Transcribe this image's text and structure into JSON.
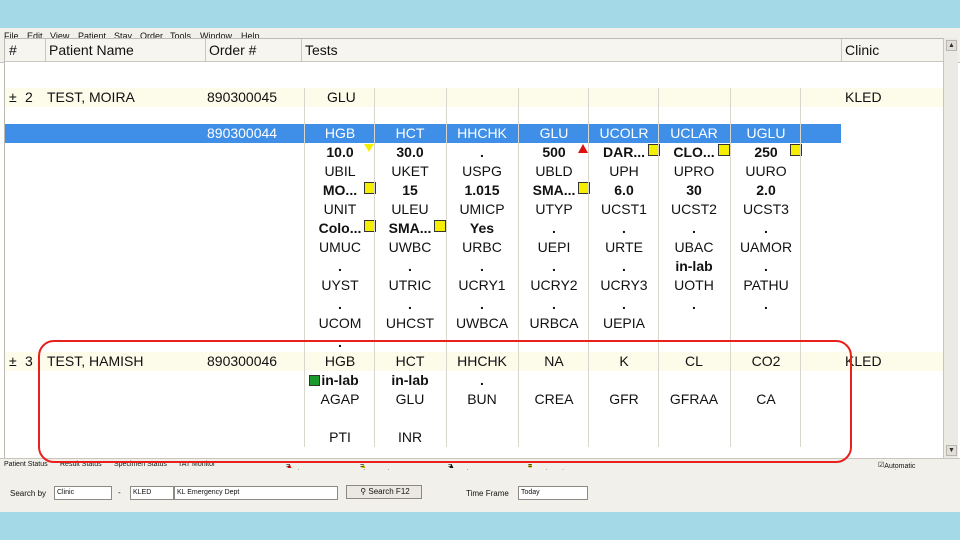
{
  "menu": [
    "File",
    "Edit",
    "View",
    "Patient",
    "Stay",
    "Order",
    "Tools",
    "Window",
    "Help"
  ],
  "columns": {
    "num": "#",
    "patient": "Patient Name",
    "order": "Order #",
    "tests": "Tests",
    "clinic": "Clinic"
  },
  "rows": [
    {
      "num": "2",
      "name": "TEST, MOIRA",
      "order": "890300045",
      "test": "GLU",
      "clinic": "KLED"
    },
    {
      "order": "890300044"
    },
    {
      "num": "3",
      "name": "TEST, HAMISH",
      "order": "890300046",
      "clinic": "KLED"
    }
  ],
  "grid": [
    [
      "HGB",
      "HCT",
      "HHCHK",
      "GLU",
      "UCOLR",
      "UCLAR",
      "UGLU"
    ],
    [
      "10.0",
      "30.0",
      ".",
      "500",
      "DAR...",
      "CLO...",
      "250"
    ],
    [
      "UBIL",
      "UKET",
      "USPG",
      "UBLD",
      "UPH",
      "UPRO",
      "UURO"
    ],
    [
      "MO...",
      "15",
      "1.015",
      "SMA...",
      "6.0",
      "30",
      "2.0"
    ],
    [
      "UNIT",
      "ULEU",
      "UMICP",
      "UTYP",
      "UCST1",
      "UCST2",
      "UCST3"
    ],
    [
      "Colo...",
      "SMA...",
      "Yes",
      ".",
      ".",
      ".",
      "."
    ],
    [
      "UMUC",
      "UWBC",
      "URBC",
      "UEPI",
      "URTE",
      "UBAC",
      "UAMOR"
    ],
    [
      ".",
      ".",
      ".",
      ".",
      ".",
      "in-lab",
      "."
    ],
    [
      "UYST",
      "UTRIC",
      "UCRY1",
      "UCRY2",
      "UCRY3",
      "UOTH",
      "PATHU"
    ],
    [
      ".",
      ".",
      ".",
      ".",
      ".",
      ".",
      "."
    ],
    [
      "UCOM",
      "UHCST",
      "UWBCA",
      "URBCA",
      "UEPIA",
      "",
      ""
    ],
    [
      ".",
      "",
      "",
      "",
      "",
      "",
      ""
    ],
    [
      "HGB",
      "HCT",
      "HHCHK",
      "NA",
      "K",
      "CL",
      "CO2"
    ],
    [
      "in-lab",
      "in-lab",
      ".",
      "",
      "",
      "",
      ""
    ],
    [
      "AGAP",
      "GLU",
      "BUN",
      "CREA",
      "GFR",
      "GFRAA",
      "CA"
    ],
    [
      "",
      "",
      "",
      "",
      "",
      "",
      ""
    ],
    [
      "PTI",
      "INR",
      "",
      "",
      "",
      "",
      ""
    ]
  ],
  "tabs": [
    "Patient Status",
    "Result Status",
    "Specimen Status",
    "TAT Monitor"
  ],
  "legend": [
    "= panic result",
    "= abnormal result",
    "= consult result",
    "= unreviewed result"
  ],
  "bottom": {
    "search_label": "Search by",
    "search_value": "Clinic",
    "clinic_code": "KLED",
    "clinic_name": "KL Emergency Dept",
    "search_button": "Search F12",
    "time_label": "Time Frame",
    "time_value": "Today",
    "auto_update": "Automatic update"
  }
}
